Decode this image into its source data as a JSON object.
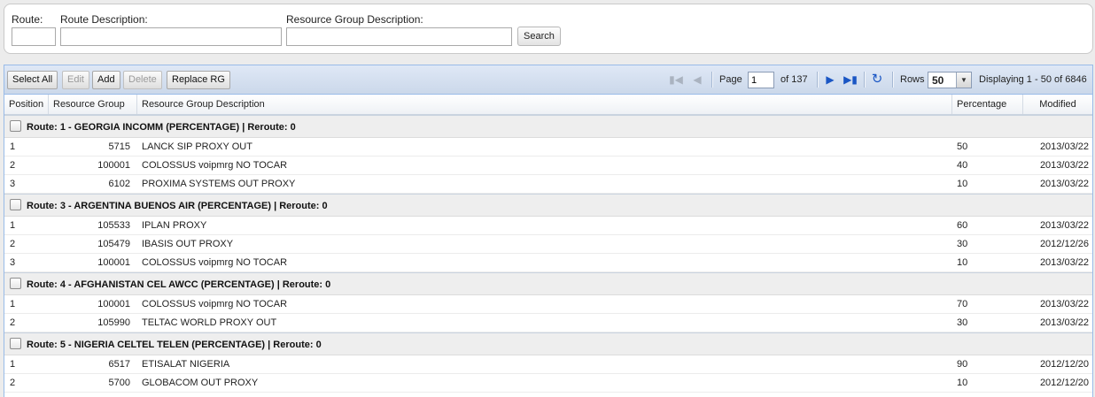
{
  "search": {
    "route_label": "Route:",
    "route_value": "",
    "route_desc_label": "Route Description:",
    "route_desc_value": "",
    "rg_desc_label": "Resource Group Description:",
    "rg_desc_value": "",
    "search_button": "Search"
  },
  "toolbar": {
    "select_all": "Select All",
    "edit": "Edit",
    "add": "Add",
    "delete": "Delete",
    "replace_rg": "Replace RG"
  },
  "pager": {
    "page_label": "Page",
    "page_value": "1",
    "of_text": "of 137",
    "rows_label": "Rows",
    "rows_value": "50",
    "displaying": "Displaying 1 - 50 of 6846"
  },
  "icons": {
    "first": "first-page-icon",
    "prev": "prev-page-icon",
    "next": "next-page-icon",
    "last": "last-page-icon",
    "refresh": "refresh-icon"
  },
  "columns": {
    "position": "Position",
    "resource_group": "Resource Group",
    "description": "Resource Group Description",
    "percentage": "Percentage",
    "modified": "Modified"
  },
  "groups": [
    {
      "title": "Route: 1 - GEORGIA INCOMM (PERCENTAGE) | Reroute: 0",
      "rows": [
        {
          "position": "1",
          "rg": "5715",
          "desc": "LANCK SIP PROXY OUT",
          "pct": "50",
          "modified": "2013/03/22"
        },
        {
          "position": "2",
          "rg": "100001",
          "desc": "COLOSSUS voipmrg NO TOCAR",
          "pct": "40",
          "modified": "2013/03/22"
        },
        {
          "position": "3",
          "rg": "6102",
          "desc": "PROXIMA SYSTEMS OUT PROXY",
          "pct": "10",
          "modified": "2013/03/22"
        }
      ]
    },
    {
      "title": "Route: 3 - ARGENTINA BUENOS AIR (PERCENTAGE) | Reroute: 0",
      "rows": [
        {
          "position": "1",
          "rg": "105533",
          "desc": "IPLAN PROXY",
          "pct": "60",
          "modified": "2013/03/22"
        },
        {
          "position": "2",
          "rg": "105479",
          "desc": "IBASIS OUT PROXY",
          "pct": "30",
          "modified": "2012/12/26"
        },
        {
          "position": "3",
          "rg": "100001",
          "desc": "COLOSSUS voipmrg NO TOCAR",
          "pct": "10",
          "modified": "2013/03/22"
        }
      ]
    },
    {
      "title": "Route: 4 - AFGHANISTAN CEL AWCC (PERCENTAGE) | Reroute: 0",
      "rows": [
        {
          "position": "1",
          "rg": "100001",
          "desc": "COLOSSUS voipmrg NO TOCAR",
          "pct": "70",
          "modified": "2013/03/22"
        },
        {
          "position": "2",
          "rg": "105990",
          "desc": "TELTAC WORLD PROXY OUT",
          "pct": "30",
          "modified": "2013/03/22"
        }
      ]
    },
    {
      "title": "Route: 5 - NIGERIA CELTEL TELEN (PERCENTAGE) | Reroute: 0",
      "rows": [
        {
          "position": "1",
          "rg": "6517",
          "desc": "ETISALAT NIGERIA",
          "pct": "90",
          "modified": "2012/12/20"
        },
        {
          "position": "2",
          "rg": "5700",
          "desc": "GLOBACOM OUT PROXY",
          "pct": "10",
          "modified": "2012/12/20"
        }
      ]
    }
  ]
}
